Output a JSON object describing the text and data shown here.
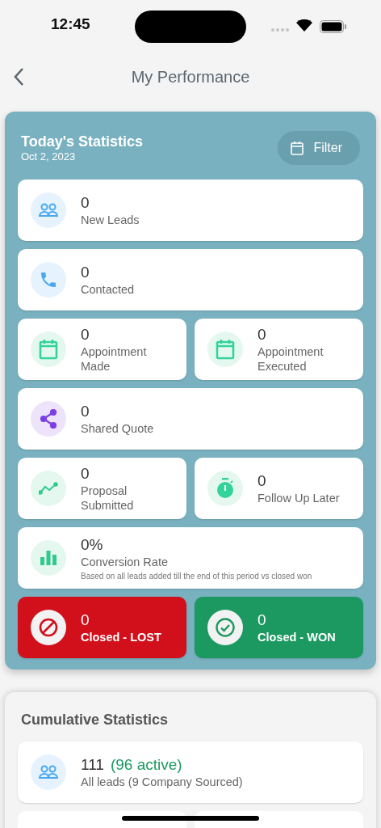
{
  "status_bar": {
    "time": "12:45"
  },
  "header": {
    "title": "My Performance"
  },
  "today": {
    "title": "Today's Statistics",
    "date": "Oct 2, 2023",
    "filter_button": "Filter",
    "rows": [
      [
        {
          "kind": "stat",
          "value": "0",
          "label": "New Leads"
        }
      ],
      [
        {
          "kind": "stat",
          "value": "0",
          "label": "Contacted"
        }
      ],
      [
        {
          "kind": "stat",
          "value": "0",
          "label": "Appointment Made"
        },
        {
          "kind": "stat",
          "value": "0",
          "label": "Appointment Executed"
        }
      ],
      [
        {
          "kind": "stat",
          "value": "0",
          "label": "Shared Quote"
        }
      ],
      [
        {
          "kind": "stat",
          "value": "0",
          "label": "Proposal Submitted"
        },
        {
          "kind": "stat",
          "value": "0",
          "label": "Follow Up Later"
        }
      ],
      [
        {
          "kind": "stat",
          "value": "0%",
          "label": "Conversion Rate",
          "note": "Based on all leads added till the end of this period vs closed won"
        }
      ],
      [
        {
          "kind": "lost",
          "value": "0",
          "label": "Closed - LOST"
        },
        {
          "kind": "won",
          "value": "0",
          "label": "Closed - WON"
        }
      ]
    ]
  },
  "cumulative": {
    "title": "Cumulative Statistics",
    "tiles": [
      {
        "kind": "stat",
        "value": "111",
        "extra": "(96 active)",
        "label": "All leads (9 Company Sourced)"
      }
    ]
  }
}
